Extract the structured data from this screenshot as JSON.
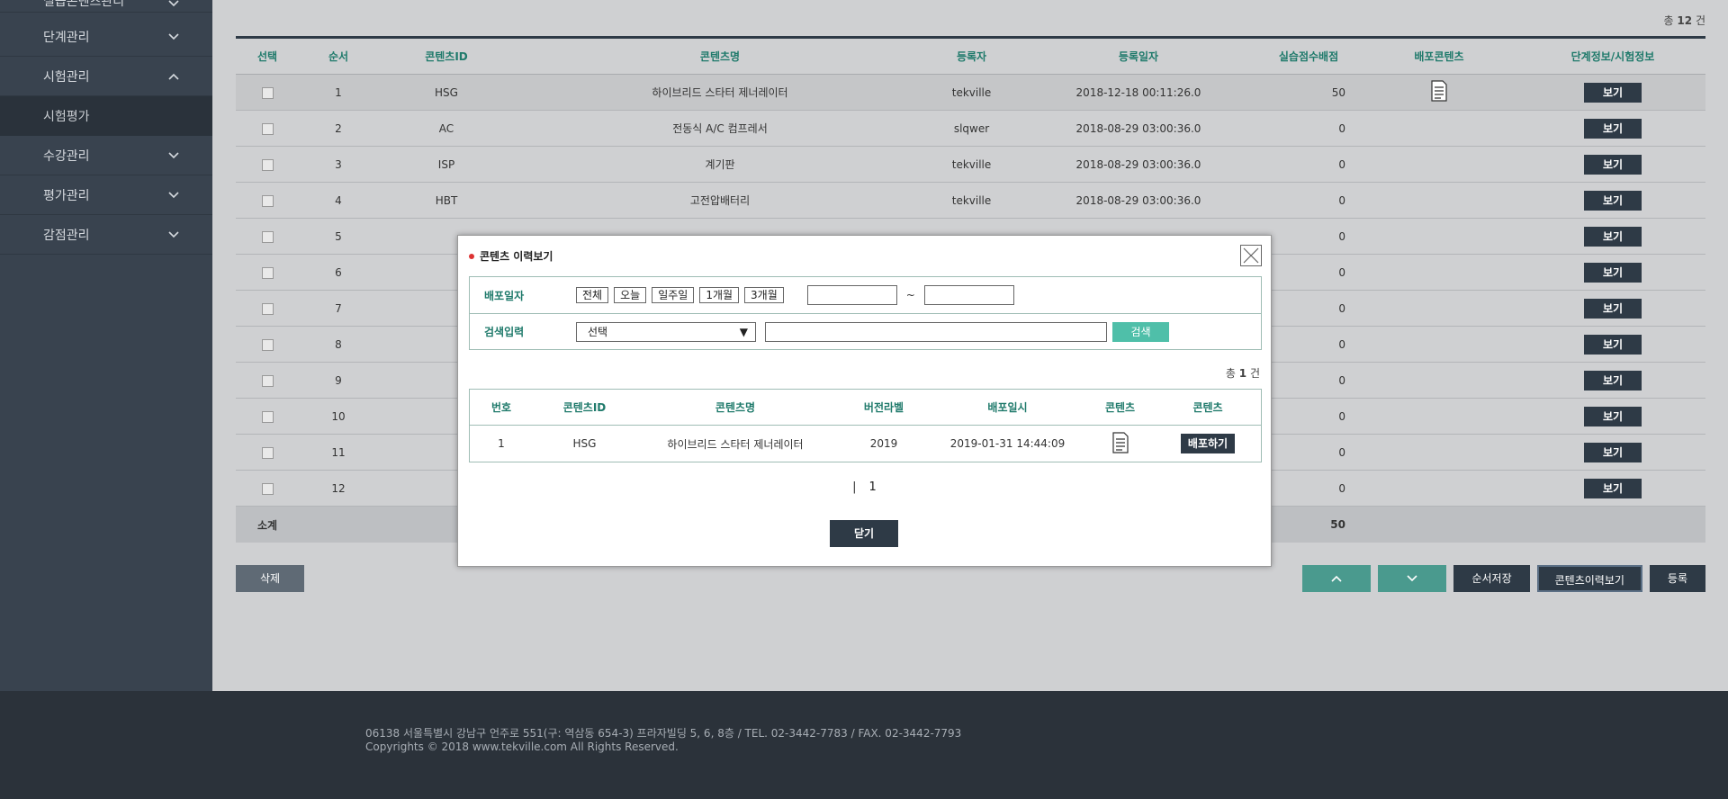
{
  "sidebar": {
    "items": [
      {
        "label": "실습콘텐츠관리",
        "expanded": false
      },
      {
        "label": "단계관리",
        "expanded": false
      },
      {
        "label": "시험관리",
        "expanded": true
      },
      {
        "label": "시험평가",
        "sub": true
      },
      {
        "label": "수강관리",
        "expanded": false
      },
      {
        "label": "평가관리",
        "expanded": false
      },
      {
        "label": "감점관리",
        "expanded": false
      }
    ]
  },
  "main": {
    "total_prefix": "총",
    "total_count": "12",
    "total_suffix": "건",
    "headers": [
      "선택",
      "순서",
      "콘텐츠ID",
      "콘텐츠명",
      "등록자",
      "등록일자",
      "실습점수배점",
      "배포콘텐츠",
      "단계정보/시험정보"
    ],
    "rows": [
      {
        "no": "1",
        "id": "HSG",
        "name": "하이브리드 스타터 제너레이터",
        "reg": "tekville",
        "date": "2018-12-18 00:11:26.0",
        "score": "50",
        "doc": true
      },
      {
        "no": "2",
        "id": "AC",
        "name": "전동식 A/C 컴프레서",
        "reg": "slqwer",
        "date": "2018-08-29 03:00:36.0",
        "score": "0",
        "doc": false
      },
      {
        "no": "3",
        "id": "ISP",
        "name": "계기판",
        "reg": "tekville",
        "date": "2018-08-29 03:00:36.0",
        "score": "0",
        "doc": false
      },
      {
        "no": "4",
        "id": "HBT",
        "name": "고전압배터리",
        "reg": "tekville",
        "date": "2018-08-29 03:00:36.0",
        "score": "0",
        "doc": false
      },
      {
        "no": "5",
        "id": "",
        "name": "",
        "reg": "",
        "date": "",
        "score": "0",
        "doc": false
      },
      {
        "no": "6",
        "id": "",
        "name": "",
        "reg": "",
        "date": "",
        "score": "0",
        "doc": false
      },
      {
        "no": "7",
        "id": "",
        "name": "",
        "reg": "",
        "date": "",
        "score": "0",
        "doc": false
      },
      {
        "no": "8",
        "id": "",
        "name": "",
        "reg": "",
        "date": "",
        "score": "0",
        "doc": false
      },
      {
        "no": "9",
        "id": "",
        "name": "",
        "reg": "",
        "date": "",
        "score": "0",
        "doc": false
      },
      {
        "no": "10",
        "id": "",
        "name": "",
        "reg": "",
        "date": "",
        "score": "0",
        "doc": false
      },
      {
        "no": "11",
        "id": "",
        "name": "",
        "reg": "",
        "date": "",
        "score": "0",
        "doc": false
      },
      {
        "no": "12",
        "id": "",
        "name": "",
        "reg": "",
        "date": "",
        "score": "0",
        "doc": false
      }
    ],
    "view_label": "보기",
    "subtotal_label": "소계",
    "subtotal_score": "50",
    "delete_label": "삭제",
    "save_order_label": "순서저장",
    "history_label": "콘텐츠이력보기",
    "register_label": "등록"
  },
  "modal": {
    "title": "콘텐츠 이력보기",
    "date_label": "배포일자",
    "date_buttons": [
      "전체",
      "오늘",
      "일주일",
      "1개월",
      "3개월"
    ],
    "tilde": "~",
    "search_label": "검색입력",
    "select_value": "선택",
    "search_button": "검색",
    "total_prefix": "총",
    "total_count": "1",
    "total_suffix": "건",
    "headers": [
      "번호",
      "콘텐츠ID",
      "콘텐츠명",
      "버전라벨",
      "배포일시",
      "콘텐츠",
      "콘텐츠"
    ],
    "rows": [
      {
        "no": "1",
        "id": "HSG",
        "name": "하이브리드 스타터 제너레이터",
        "version": "2019",
        "datetime": "2019-01-31 14:44:09",
        "action": "배포하기"
      }
    ],
    "page_sep": "|",
    "page": "1",
    "close_label": "닫기"
  },
  "footer": {
    "address": "06138 서울특별시 강남구 언주로 551(구: 역삼동 654-3) 프라자빌딩 5, 6, 8층 / TEL. 02-3442-7783 / FAX. 02-3442-7793",
    "copyright": "Copyrights © 2018 www.tekville.com All Rights Reserved."
  },
  "colors": {
    "accent": "#1f7a6b",
    "dark": "#2e3a46",
    "teal_button": "#4fbfa9",
    "sidebar": "#39434f"
  }
}
